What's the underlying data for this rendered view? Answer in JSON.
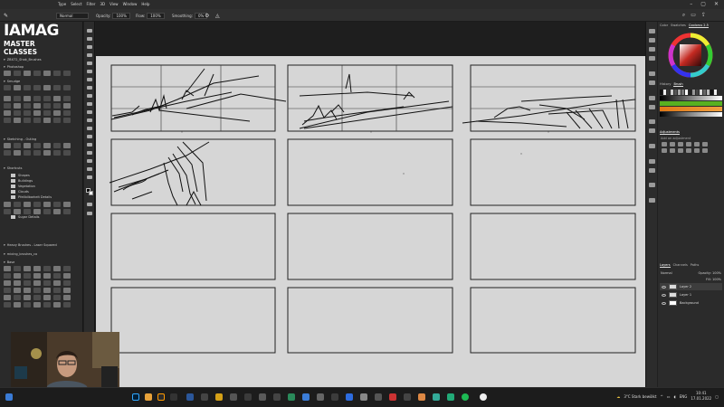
{
  "menubar": {
    "items": [
      "Type",
      "Select",
      "Filter",
      "3D",
      "View",
      "Window",
      "Help"
    ],
    "window_controls": [
      "minimize-icon",
      "maximize-icon",
      "close-icon"
    ]
  },
  "options_bar": {
    "mode_label": "Normal",
    "opacity_label": "Opacity:",
    "opacity_value": "100%",
    "flow_label": "Flow:",
    "flow_value": "100%",
    "smoothing_label": "Smoothing:",
    "smoothing_value": "0%"
  },
  "brand": {
    "line1": "IAMAG",
    "line2": "MASTER CLASSES"
  },
  "brushes": {
    "groups": [
      "ZBX72_Shak_Brushes",
      "Photoshop",
      "Smudge",
      "Sketching - Outing",
      "Shortcuts",
      "Heavy Brushes - Laser Squared",
      "mixing_brushes_co",
      "Base"
    ],
    "folders": [
      "Shapes",
      "Buildings",
      "Vegetation",
      "Clouds",
      "Pfeilbilbarkeit Details",
      "Sugar Details"
    ]
  },
  "right_panel": {
    "color_tabs": [
      "Color",
      "Swatches",
      "Coolorus 2.5"
    ],
    "sub_tabs": [
      "History",
      "Brush"
    ],
    "adjustments_title": "Adjustments",
    "adjustments_hint": "Add an adjustment",
    "layers_tabs": [
      "Layers",
      "Channels",
      "Paths"
    ],
    "blend_mode": "Normal",
    "opacity_label": "Opacity:",
    "opacity_value": "100%",
    "fill_label": "Fill:",
    "fill_value": "100%",
    "layers": [
      {
        "name": "Layer 2",
        "selected": true
      },
      {
        "name": "Layer 1",
        "selected": false
      },
      {
        "name": "Background",
        "selected": false
      }
    ],
    "colors": {
      "wheel_center": "#c42a22",
      "bar_green": "#58b020",
      "bar_orange": "#e07818"
    }
  },
  "taskbar": {
    "weather": "3°C Stark bewölkt",
    "language": "ENG",
    "time": "10:41",
    "date": "17.01.2022"
  }
}
